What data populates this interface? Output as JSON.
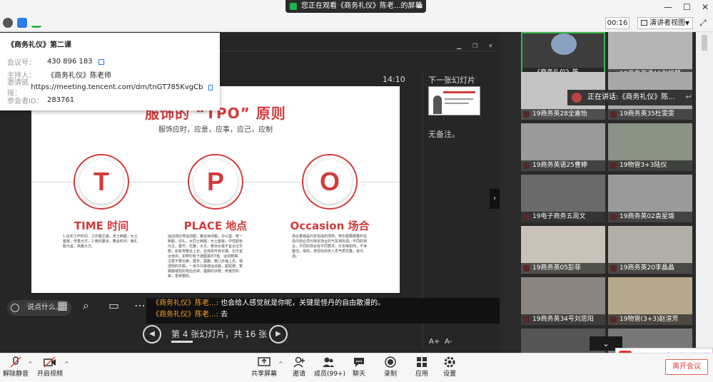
{
  "share_banner": {
    "text": "您正在观看《商务礼仪》陈老...的屏幕"
  },
  "header": {
    "timer": "00:16",
    "view_mode": "演讲者视图"
  },
  "info_card": {
    "title": "《商务礼仪》第二课",
    "rows": [
      {
        "key": "会议号：",
        "value": "430 896 183"
      },
      {
        "key": "主持人：",
        "value": "《商务礼仪》陈老师"
      },
      {
        "key": "邀请链接：",
        "value": "https://meeting.tencent.com/dm/tnGT785KvgCb"
      },
      {
        "key": "参会者ID：",
        "value": "283761"
      }
    ]
  },
  "presentation": {
    "time": "14:10",
    "next_label": "下一张幻灯片",
    "notes": "无备注。",
    "nav_text": "第 4 张幻灯片，共 16 张",
    "say_placeholder": "说点什么...",
    "slide": {
      "title": "服饰的 “TPO” 原则",
      "subtitle": "服饰应时，应景，应事，应己，应制",
      "columns": [
        {
          "letter": "T",
          "heading": "TIME 时间",
          "text": "1.白天工作时间：工作服正装，男士西服，女士套装，传重大方。2.晚间宴会、舞会时间：晚礼服为宜，高雅大方。"
        },
        {
          "letter": "P",
          "heading": "PLACE 地点",
          "text": "运动场应穿运动服，聚会休闲服，办公室：统一制服，切礼，女同士西服，女士套装。中性颜色为主，整齐，优雅，大方。着休女装不宜太过华丽，如有穿着丝上衣，丝袜高开衩长裙。也不宜太休闲，如穿印有卡通图案的T恤、运动鞋等。注意不要出裤，露背，露腹，着口无袖上衣，或透明的衣服，一身牛仔装或运动装，超短裙，宽脚膝或短的背后丝袜，露脚的凉鞋，奇装异的等，更称要防。"
        },
        {
          "letter": "O",
          "heading": "Occasion 场合",
          "text": "场合着装是约定俗成的惯例，穿衣服要顺着的信息内容必须与特定场合的气氛相协调。不同的场合，不同的场合有不同要求，打扮得如何，干净整洁，得体，表现出商务人员气质优雅，有内涵。"
        }
      ]
    }
  },
  "chat": [
    {
      "name": "《商务礼仪》陈老...:",
      "text": "也会给人感觉就是你呢，关键是怪丹的自由散漫的。"
    },
    {
      "name": "《商务礼仪》陈老...:",
      "text": "去"
    }
  ],
  "speaking": {
    "text": "正在讲话:《商务礼仪》陈..."
  },
  "participants": [
    {
      "name": "《商务礼仪》陈...",
      "active": true
    },
    {
      "name": "19商务英语15张梓慧"
    },
    {
      "name": "19商务英28全嘉怡"
    },
    {
      "name": "19商务英35杜雯雯"
    },
    {
      "name": "19商务英语25曹婷"
    },
    {
      "name": "19物管3+3陆仪"
    },
    {
      "name": "19电子商务五周文"
    },
    {
      "name": "19商务英02袁星瑜"
    },
    {
      "name": "19商务英05彭菲"
    },
    {
      "name": "19商务英20李晶晶"
    },
    {
      "name": "19商务英34号刘思阳"
    },
    {
      "name": "19物管(3+3)赵渲芳"
    }
  ],
  "ime": {
    "letter": "S",
    "text": "中"
  },
  "toolbar": {
    "unmute": "解除静音",
    "start_video": "开启视频",
    "share_screen": "共享屏幕",
    "invite": "邀请",
    "members": "成员(99+)",
    "chat": "聊天",
    "record": "录制",
    "apps": "应用",
    "settings": "设置",
    "leave": "离开会议"
  }
}
